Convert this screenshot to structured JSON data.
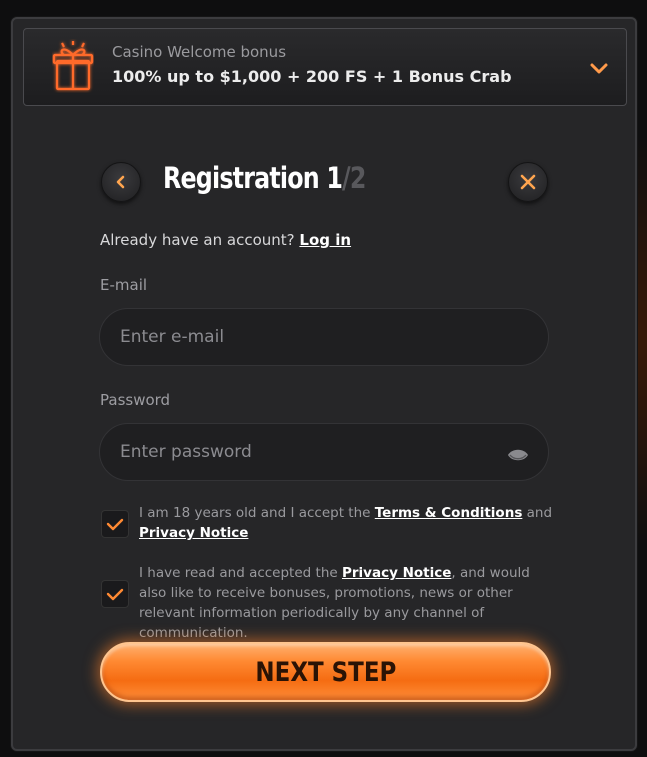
{
  "bonus": {
    "subtitle": "Casino Welcome bonus",
    "title": "100% up to $1,000 + 200 FS + 1 Bonus Crab"
  },
  "header": {
    "title_main": "Registration 1",
    "title_dim": "/2"
  },
  "login_prompt": {
    "text": "Already have an account?",
    "link": "Log in"
  },
  "email": {
    "label": "E-mail",
    "placeholder": "Enter e-mail"
  },
  "password": {
    "label": "Password",
    "placeholder": "Enter password"
  },
  "consent_terms": {
    "text_before": "I am 18 years old and I accept the",
    "terms_link": "Terms & Conditions",
    "and": "and",
    "privacy_link": "Privacy Notice",
    "checked": true
  },
  "consent_marketing": {
    "text_before": "I have read and accepted the",
    "privacy_link": "Privacy Notice",
    "text_after": ", and would also like to receive bonuses, promotions, news or other relevant information periodically by any channel of communication.",
    "checked": true
  },
  "next_button": {
    "label": "NEXT STEP"
  },
  "icons": {
    "gift": "gift-icon",
    "chevron": "chevron-down-icon",
    "back": "chevron-left-icon",
    "close": "close-icon",
    "eye": "eye-icon",
    "check": "check-icon"
  },
  "colors": {
    "accent": "#ff8a33",
    "panel": "#262628",
    "input_bg": "#1f1f21"
  }
}
